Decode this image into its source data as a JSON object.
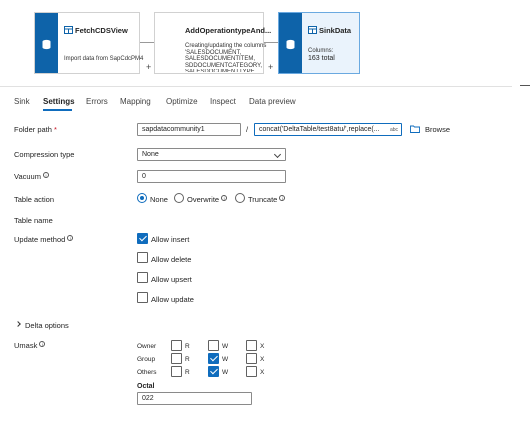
{
  "pipeline": {
    "nodes": [
      {
        "title": "FetchCDSView",
        "desc": [
          "Import data from SapCdcPM4"
        ]
      },
      {
        "title": "AddOperationtypeAnd...",
        "desc": [
          "Creating/updating the columns",
          "'SALESDOCUMENT,",
          "SALESDOCUMENTITEM,",
          "SDDOCUMENTCATEGORY,",
          "SALESDOCUMENTTYPE"
        ]
      },
      {
        "title": "SinkData",
        "desc": [
          "Columns:",
          "163 total"
        ]
      }
    ],
    "plus": "+"
  },
  "tabs": [
    "Sink",
    "Settings",
    "Errors",
    "Mapping",
    "Optimize",
    "Inspect",
    "Data preview"
  ],
  "active_tab": "Settings",
  "form": {
    "folder_path": {
      "label": "Folder path",
      "required_mark": "*",
      "container": "sapdatacommunity1",
      "separator": "/",
      "directory": "concat('DeltaTable/test8atu/',replace(...",
      "abc": "abc",
      "browse": "Browse"
    },
    "compression": {
      "label": "Compression type",
      "value": "None"
    },
    "vacuum": {
      "label": "Vacuum",
      "value": "0"
    },
    "table_action": {
      "label": "Table action",
      "options": [
        "None",
        "Overwrite",
        "Truncate"
      ],
      "selected": "None"
    },
    "table_name": {
      "label": "Table name"
    },
    "update_method": {
      "label": "Update method",
      "options": [
        {
          "label": "Allow insert",
          "checked": true
        },
        {
          "label": "Allow delete",
          "checked": false
        },
        {
          "label": "Allow upsert",
          "checked": false
        },
        {
          "label": "Allow update",
          "checked": false
        }
      ]
    },
    "delta_options": {
      "label": "Delta options"
    },
    "umask": {
      "label": "Umask",
      "rows": [
        {
          "label": "Owner",
          "r": false,
          "w": false,
          "x": false
        },
        {
          "label": "Group",
          "r": false,
          "w": true,
          "x": false
        },
        {
          "label": "Others",
          "r": false,
          "w": true,
          "x": false
        }
      ],
      "col_r": "R",
      "col_w": "W",
      "col_x": "X",
      "octal_label": "Octal",
      "octal_value": "022"
    }
  },
  "colors": {
    "accent": "#0f6cbd",
    "node_bar": "#0e63a9",
    "required": "#c50f1f"
  }
}
